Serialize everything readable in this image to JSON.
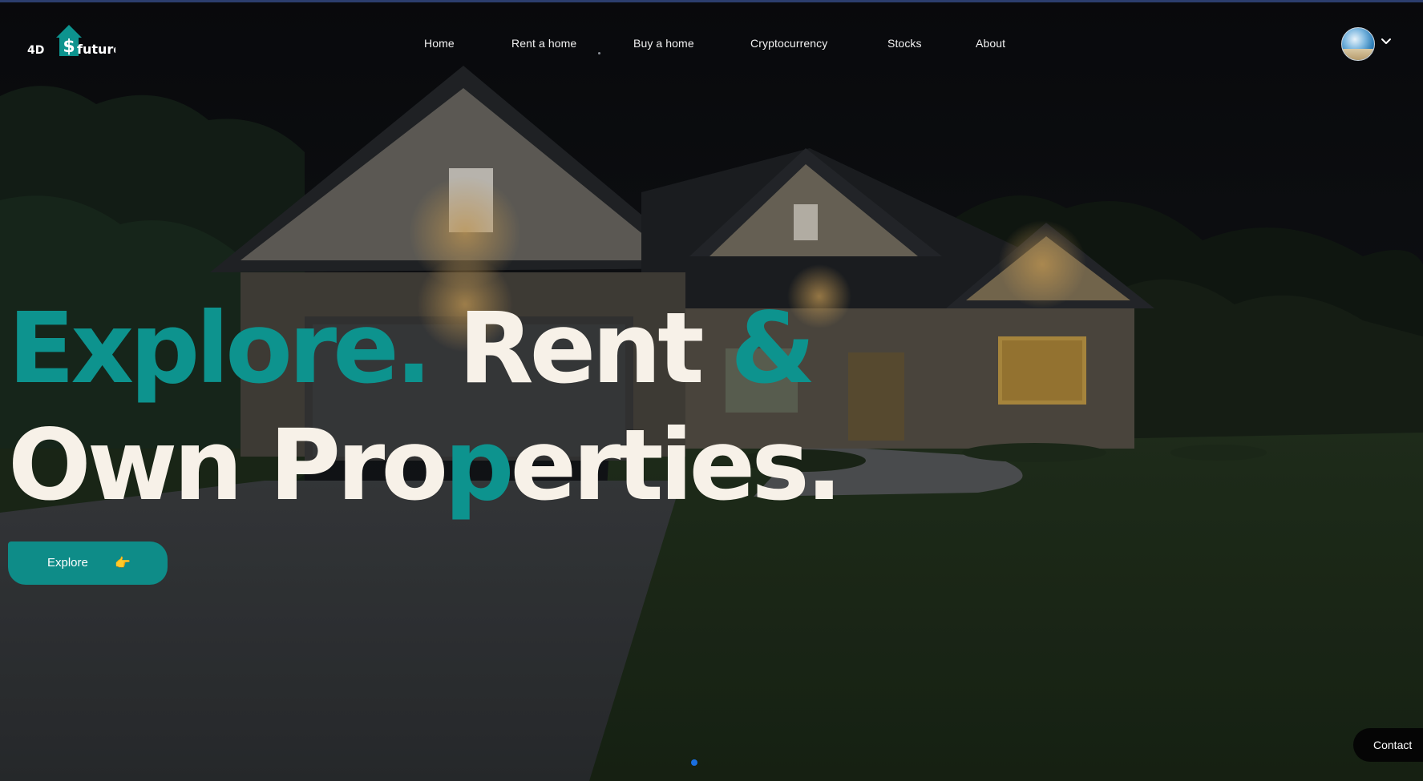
{
  "brand": {
    "logo_text_prefix": "4D",
    "logo_text_suffix": "future",
    "logo_symbol": "$",
    "accent_color": "#0d938e"
  },
  "nav": {
    "items": [
      {
        "label": "Home"
      },
      {
        "label": "Rent a home"
      },
      {
        "label": "Buy a home"
      },
      {
        "label": "Cryptocurrency"
      },
      {
        "label": "Stocks"
      },
      {
        "label": "About"
      }
    ]
  },
  "user_menu": {
    "avatar_icon": "user-avatar",
    "dropdown_icon": "chevron-down-icon"
  },
  "hero": {
    "line1_part1": "Explore.",
    "line1_part2": "Rent",
    "line1_part3": "&",
    "line2_part1": "Own Pro",
    "line2_part2": "p",
    "line2_part3": "erties.",
    "cta_label": "Explore",
    "cta_icon": "👉"
  },
  "carousel": {
    "active_index": 0,
    "indicator_color": "#1a6fe0"
  },
  "contact": {
    "label": "Contact"
  }
}
